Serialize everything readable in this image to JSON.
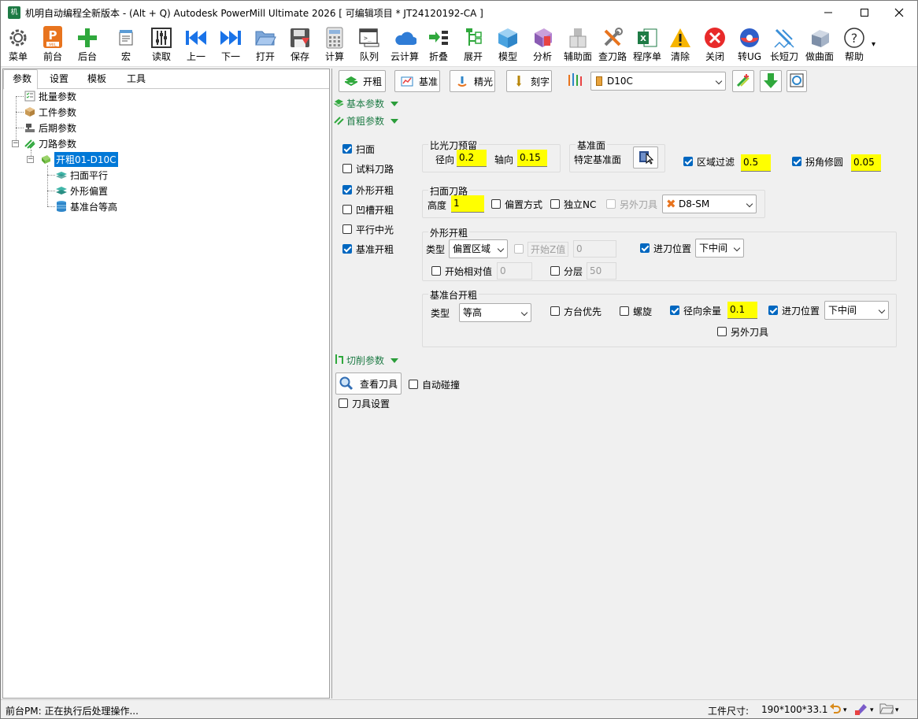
{
  "window": {
    "title": "机明自动编程全新版本 - (Alt + Q) Autodesk PowerMill Ultimate 2026    [ 可编辑项目 * JT24120192-CA ]",
    "app_icon_text": "机",
    "minimize": "—",
    "maximize": "☐",
    "close": "✕"
  },
  "toolbar": {
    "items": [
      {
        "label": "菜单",
        "icon": "gear-icon"
      },
      {
        "label": "前台",
        "icon": "powermill-logo-icon"
      },
      {
        "label": "后台",
        "icon": "plus-icon"
      },
      {
        "label": "宏",
        "icon": "macro-icon"
      },
      {
        "label": "读取",
        "icon": "sliders-icon"
      },
      {
        "label": "上一",
        "icon": "skip-back-icon"
      },
      {
        "label": "下一",
        "icon": "skip-forward-icon"
      },
      {
        "label": "打开",
        "icon": "folder-open-icon"
      },
      {
        "label": "保存",
        "icon": "save-icon"
      },
      {
        "label": "计算",
        "icon": "calculator-icon"
      },
      {
        "label": "队列",
        "icon": "queue-terminal-icon"
      },
      {
        "label": "云计算",
        "icon": "cloud-icon"
      },
      {
        "label": "折叠",
        "icon": "collapse-list-icon"
      },
      {
        "label": "展开",
        "icon": "expand-tree-icon"
      },
      {
        "label": "模型",
        "icon": "cube-icon"
      },
      {
        "label": "分析",
        "icon": "analysis-icon"
      },
      {
        "label": "辅助面",
        "icon": "aux-surface-icon"
      },
      {
        "label": "查刀路",
        "icon": "tools-icon"
      },
      {
        "label": "程序单",
        "icon": "excel-icon"
      },
      {
        "label": "清除",
        "icon": "warning-icon"
      },
      {
        "label": "关闭",
        "icon": "close-circle-icon"
      },
      {
        "label": "转UG",
        "icon": "ug-icon"
      },
      {
        "label": "长短刀",
        "icon": "long-short-tool-icon"
      },
      {
        "label": "做曲面",
        "icon": "surface-box-icon"
      },
      {
        "label": "帮助",
        "icon": "help-icon"
      }
    ],
    "overflow": "▾"
  },
  "left_tabs": [
    "参数",
    "设置",
    "模板",
    "工具"
  ],
  "tree": {
    "batch": "批量参数",
    "workpiece": "工件参数",
    "post": "后期参数",
    "toolpath": "刀路参数",
    "selected": "开粗01-D10C",
    "children": [
      "扫面平行",
      "外形偏置",
      "基准台等高"
    ]
  },
  "top_buttons": {
    "rough": "开粗",
    "datum": "基准",
    "finish": "精光",
    "engrave": "刻字",
    "tool_select": "D10C"
  },
  "sections": {
    "basic": "基本参数",
    "first_rough": "首粗参数",
    "cutting": "切削参数"
  },
  "left_checks": [
    {
      "label": "扫面",
      "checked": true
    },
    {
      "label": "试料刀路",
      "checked": false
    },
    {
      "label": "外形开粗",
      "checked": true
    },
    {
      "label": "凹槽开粗",
      "checked": false
    },
    {
      "label": "平行中光",
      "checked": false
    },
    {
      "label": "基准开粗",
      "checked": true
    }
  ],
  "finish_allowance": {
    "title": "比光刀预留",
    "radial_label": "径向",
    "radial": "0.2",
    "axial_label": "轴向",
    "axial": "0.15"
  },
  "datum_face": {
    "title": "基准面",
    "label": "特定基准面"
  },
  "region_filter": {
    "label": "区域过滤",
    "checked": true,
    "value": "0.5"
  },
  "corner_fix": {
    "label": "拐角修圆",
    "checked": true,
    "value": "0.05"
  },
  "face_path": {
    "title": "扫面刀路",
    "height_label": "高度",
    "height": "1",
    "offset_mode": "偏置方式",
    "independent_nc": "独立NC",
    "other_tool": "另外刀具",
    "tool": "D8-SM"
  },
  "outline_rough": {
    "title": "外形开粗",
    "type_label": "类型",
    "type": "偏置区域",
    "start_z": "开始Z值",
    "start_z_value": "0",
    "entry_label": "进刀位置",
    "entry": "下中间",
    "start_rel": "开始相对值",
    "start_rel_value": "0",
    "layer_label": "分层",
    "layer_value": "50"
  },
  "datum_rough": {
    "title": "基准台开粗",
    "type_label": "类型",
    "type": "等高",
    "square_first": "方台优先",
    "spiral": "螺旋",
    "radial_label": "径向余量",
    "radial": "0.1",
    "entry_label": "进刀位置",
    "entry": "下中间",
    "other_tool": "另外刀具"
  },
  "cutting": {
    "view_tool": "查看刀具",
    "auto_collision": "自动碰撞",
    "tool_settings": "刀具设置"
  },
  "status": {
    "message": "前台PM: 正在执行后处理操作...",
    "size_label": "工件尺寸:",
    "size_value": "190*100*33.1"
  },
  "colors": {
    "highlight": "#ffff00",
    "accent": "#0067c0",
    "green": "#1e7b45"
  }
}
